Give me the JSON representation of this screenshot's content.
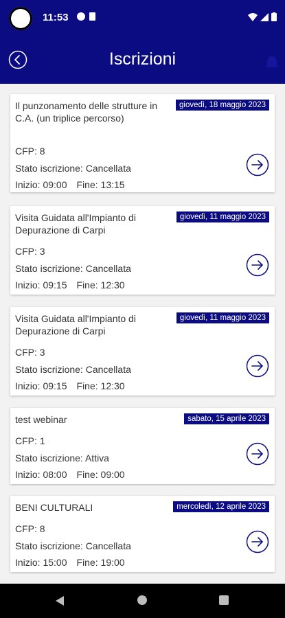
{
  "status": {
    "time": "11:53"
  },
  "header": {
    "title": "Iscrizioni"
  },
  "labels": {
    "cfp": "CFP:",
    "stato": "Stato iscrizione:",
    "inizio": "Inizio:",
    "fine": "Fine:"
  },
  "cards": [
    {
      "title": "Il punzonamento delle strutture in C.A. (un triplice percorso)",
      "date": "giovedì, 18 maggio 2023",
      "cfp": "8",
      "stato": "Cancellata",
      "inizio": "09:00",
      "fine": "13:15"
    },
    {
      "title": "Visita Guidata all'Impianto di Depurazione di Carpi",
      "date": "giovedì, 11 maggio 2023",
      "cfp": "3",
      "stato": "Cancellata",
      "inizio": "09:15",
      "fine": "12:30"
    },
    {
      "title": "Visita Guidata all'Impianto di Depurazione di Carpi",
      "date": "giovedì, 11 maggio 2023",
      "cfp": "3",
      "stato": "Cancellata",
      "inizio": "09:15",
      "fine": "12:30"
    },
    {
      "title": "test webinar",
      "date": "sabato, 15 aprile 2023",
      "cfp": "1",
      "stato": "Attiva",
      "inizio": "08:00",
      "fine": "09:00"
    },
    {
      "title": "BENI CULTURALI",
      "date": "mercoledì, 12 aprile 2023",
      "cfp": "8",
      "stato": "Cancellata",
      "inizio": "15:00",
      "fine": "19:00"
    }
  ],
  "colors": {
    "primary": "#0b0b82",
    "background": "#f2f2f2"
  }
}
